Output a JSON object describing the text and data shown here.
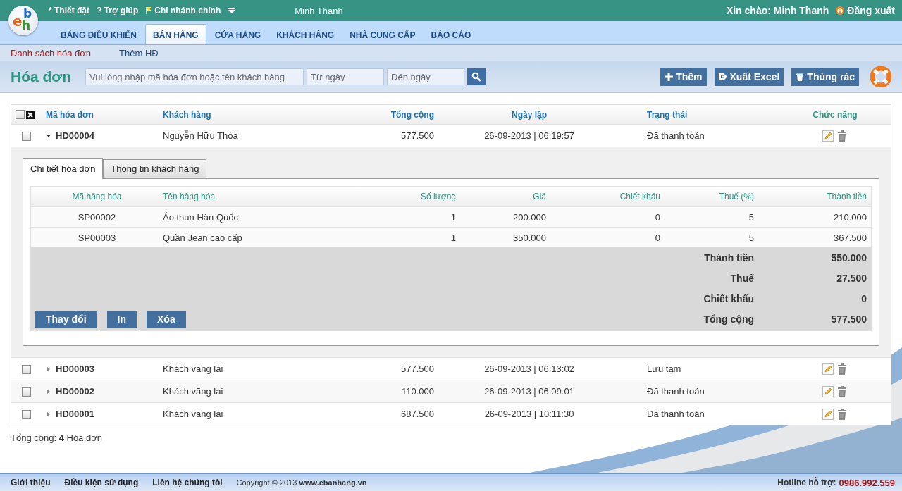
{
  "logo": {
    "letters": [
      {
        "char": "e",
        "color": "#e8641e"
      },
      {
        "char": "b",
        "color": "#1f6fc4"
      },
      {
        "char": "h",
        "color": "#3a9a2e"
      }
    ]
  },
  "topbar": {
    "links": [
      {
        "icon_char": "*",
        "label": "Thiết đặt"
      },
      {
        "icon_char": "?",
        "label": "Trợ giúp"
      }
    ],
    "branch": "Chi nhánh chính",
    "user": "Minh Thanh",
    "greeting": "Xin chào: Minh Thanh",
    "logout": "Đăng xuất"
  },
  "nav_tabs": [
    {
      "label": "BẢNG ĐIỀU KHIỂN",
      "selected": false
    },
    {
      "label": "BÁN HÀNG",
      "selected": true
    },
    {
      "label": "CỬA HÀNG",
      "selected": false
    },
    {
      "label": "KHÁCH HÀNG",
      "selected": false
    },
    {
      "label": "NHÀ CUNG CẤP",
      "selected": false
    },
    {
      "label": "BÁO CÁO",
      "selected": false
    }
  ],
  "sub_nav": [
    {
      "label": "Danh sách hóa đơn",
      "selected": true
    },
    {
      "label": "Thêm HĐ",
      "selected": false
    }
  ],
  "toolbar": {
    "title": "Hóa đơn",
    "search_placeholder": "Vui lòng nhập mã hóa đơn hoặc tên khách hàng",
    "from_placeholder": "Từ ngày",
    "to_placeholder": "Đến ngày",
    "buttons": [
      {
        "kind": "add",
        "label": "Thêm"
      },
      {
        "kind": "export",
        "label": "Xuất Excel"
      },
      {
        "kind": "trash",
        "label": "Thùng rác"
      }
    ]
  },
  "table": {
    "all_checked": false,
    "columns": [
      "Mã hóa đơn",
      "Khách hàng",
      "Tổng cộng",
      "Ngày lập",
      "Trạng thái",
      "Chức năng"
    ],
    "rows": [
      {
        "checked": false,
        "expanded": true,
        "code": "HD00004",
        "customer": "Nguyễn Hữu Thỏa",
        "total": "577.500",
        "date": "26-09-2013 | 06:19:57",
        "status": "Đã thanh toán"
      },
      {
        "checked": false,
        "expanded": false,
        "code": "HD00003",
        "customer": "Khách vãng lai",
        "total": "577.500",
        "date": "26-09-2013 | 06:13:02",
        "status": "Lưu tạm"
      },
      {
        "checked": false,
        "expanded": false,
        "code": "HD00002",
        "customer": "Khách vãng lai",
        "total": "110.000",
        "date": "26-09-2013 | 06:09:01",
        "status": "Đã thanh toán"
      },
      {
        "checked": false,
        "expanded": false,
        "code": "HD00001",
        "customer": "Khách vãng lai",
        "total": "687.500",
        "date": "26-09-2013 | 10:11:30",
        "status": "Đã thanh toán"
      }
    ]
  },
  "detail": {
    "tabs": [
      {
        "label": "Chi tiết hóa đơn",
        "selected": true
      },
      {
        "label": "Thông tin khách hàng",
        "selected": false
      }
    ],
    "columns": [
      "Mã hàng hóa",
      "Tên hàng hóa",
      "Số lượng",
      "Giá",
      "Chiết khấu",
      "Thuế (%)",
      "Thành tiền"
    ],
    "items": [
      {
        "code": "SP00002",
        "name": "Áo thun Hàn Quốc",
        "qty": "1",
        "price": "200.000",
        "discount": "0",
        "tax": "5",
        "amount": "210.000"
      },
      {
        "code": "SP00003",
        "name": "Quần Jean cao cấp",
        "qty": "1",
        "price": "350.000",
        "discount": "0",
        "tax": "5",
        "amount": "367.500"
      }
    ],
    "summary": [
      {
        "label": "Thành tiền",
        "value": "550.000"
      },
      {
        "label": "Thuế",
        "value": "27.500"
      },
      {
        "label": "Chiết khấu",
        "value": "0"
      },
      {
        "label": "Tổng cộng",
        "value": "577.500"
      }
    ],
    "actions": [
      "Thay đổi",
      "In",
      "Xóa"
    ]
  },
  "total_line": "Tổng cộng: **4** Hóa đơn",
  "footer": {
    "links": [
      "Giới thiệu",
      "Điều kiện sử dụng",
      "Liên hệ chúng tôi"
    ],
    "copyright": "Copyright © 2013 **www.ebanhang.vn**",
    "hotline_label": "Hotline hỗ trợ:",
    "hotline": "0986.992.559"
  }
}
